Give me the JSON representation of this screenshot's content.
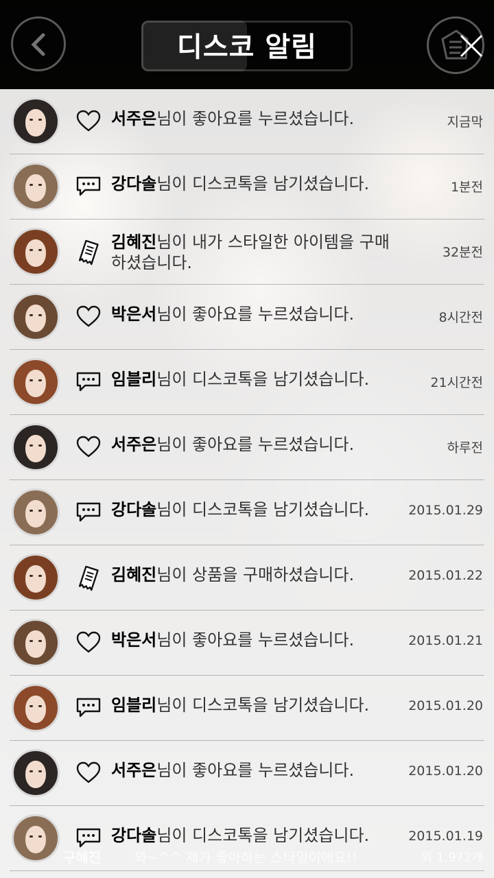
{
  "header": {
    "title": "디스코 알림"
  },
  "notifications": [
    {
      "name": "서주은",
      "text": "님이 좋아요를 누르셨습니다.",
      "time": "지금막",
      "type": "heart-icon"
    },
    {
      "name": "강다솔",
      "text": "님이 디스코톡을 남기셨습니다.",
      "time": "1분전",
      "type": "comment-icon"
    },
    {
      "name": "김혜진",
      "text": "님이 내가 스타일한 아이템을 구매하셨습니다.",
      "time": "32분전",
      "type": "receipt-icon"
    },
    {
      "name": "박은서",
      "text": "님이 좋아요를 누르셨습니다.",
      "time": "8시간전",
      "type": "heart-icon"
    },
    {
      "name": "임블리",
      "text": "님이 디스코톡을 남기셨습니다.",
      "time": "21시간전",
      "type": "comment-icon"
    },
    {
      "name": "서주은",
      "text": "님이 좋아요를 누르셨습니다.",
      "time": "하루전",
      "type": "heart-icon"
    },
    {
      "name": "강다솔",
      "text": "님이 디스코톡을 남기셨습니다.",
      "time": "2015.01.29",
      "type": "comment-icon"
    },
    {
      "name": "김혜진",
      "text": "님이 상품을 구매하셨습니다.",
      "time": "2015.01.22",
      "type": "receipt-icon"
    },
    {
      "name": "박은서",
      "text": "님이 좋아요를 누르셨습니다.",
      "time": "2015.01.21",
      "type": "heart-icon"
    },
    {
      "name": "임블리",
      "text": "님이 디스코톡을 남기셨습니다.",
      "time": "2015.01.20",
      "type": "comment-icon"
    },
    {
      "name": "서주은",
      "text": "님이 좋아요를 누르셨습니다.",
      "time": "2015.01.20",
      "type": "heart-icon"
    },
    {
      "name": "강다솔",
      "text": "님이 디스코톡을 남기셨습니다.",
      "time": "2015.01.19",
      "type": "comment-icon"
    }
  ],
  "background_feed": {
    "user": "구혜진",
    "comment": "와~^^ 제가 좋아하는 스타일이에요!!",
    "count": "외 1,972개"
  },
  "colors": {
    "header_bg": "#000000",
    "list_bg": "#ffffff",
    "separator": "#b4b4b4"
  }
}
